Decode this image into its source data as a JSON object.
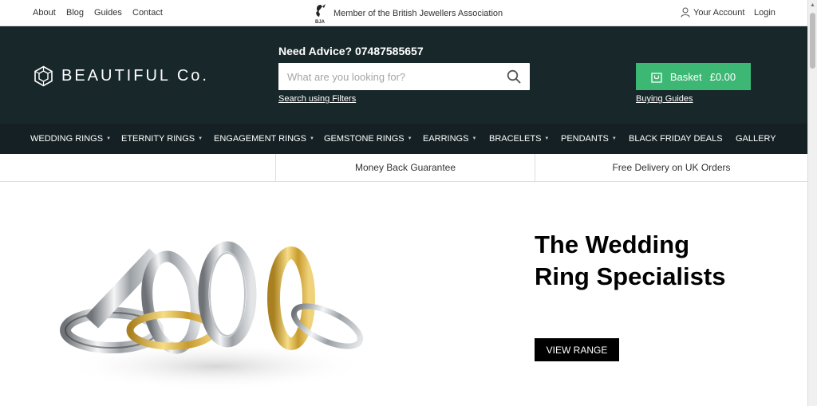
{
  "topbar": {
    "links": [
      "About",
      "Blog",
      "Guides",
      "Contact"
    ],
    "membership_text": "Member of the British Jewellers Association",
    "bja_badge": "BJA",
    "account_label": "Your Account",
    "login_label": "Login"
  },
  "header": {
    "brand_name": "BEAUTIFUL Co.",
    "advice_label": "Need Advice?",
    "advice_phone": "07487585657",
    "search_placeholder": "What are you looking for?",
    "filters_link": "Search using Filters",
    "basket_label": "Basket",
    "basket_total": "£0.00",
    "buying_guides_link": "Buying Guides"
  },
  "nav": {
    "items": [
      {
        "label": "WEDDING RINGS",
        "has_dropdown": true
      },
      {
        "label": "ETERNITY RINGS",
        "has_dropdown": true
      },
      {
        "label": "ENGAGEMENT RINGS",
        "has_dropdown": true
      },
      {
        "label": "GEMSTONE RINGS",
        "has_dropdown": true
      },
      {
        "label": "EARRINGS",
        "has_dropdown": true
      },
      {
        "label": "BRACELETS",
        "has_dropdown": true
      },
      {
        "label": "PENDANTS",
        "has_dropdown": true
      },
      {
        "label": "BLACK FRIDAY DEALS",
        "has_dropdown": false
      },
      {
        "label": "GALLERY",
        "has_dropdown": false
      }
    ]
  },
  "benefits": {
    "items": [
      "Money Back Guarantee",
      "Free Delivery on UK Orders"
    ]
  },
  "hero": {
    "title": "The Wedding Ring Specialists",
    "cta_label": "VIEW RANGE"
  },
  "colors": {
    "header_bg": "#18272a",
    "nav_bg": "#142023",
    "basket_green": "#3db874",
    "cta_black": "#000000"
  }
}
